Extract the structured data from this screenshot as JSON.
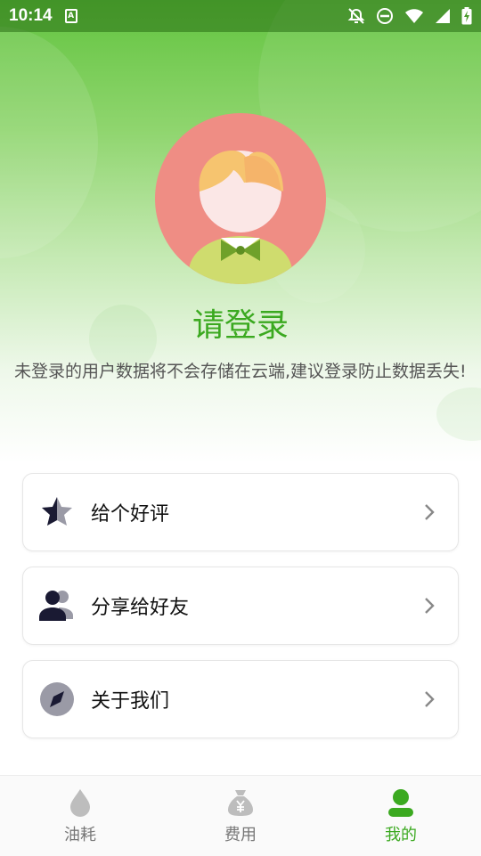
{
  "status_bar": {
    "time": "10:14",
    "notif_letter": "A"
  },
  "profile": {
    "login_title": "请登录",
    "login_desc": "未登录的用户数据将不会存储在云端,建议登录防止数据丢失!"
  },
  "menu": [
    {
      "label": "给个好评",
      "icon": "star-icon"
    },
    {
      "label": "分享给好友",
      "icon": "users-icon"
    },
    {
      "label": "关于我们",
      "icon": "compass-icon"
    }
  ],
  "tabs": [
    {
      "label": "油耗",
      "icon": "drop-icon",
      "active": false
    },
    {
      "label": "费用",
      "icon": "money-bag-icon",
      "active": false
    },
    {
      "label": "我的",
      "icon": "person-icon",
      "active": true
    }
  ],
  "colors": {
    "accent": "#3ba920",
    "avatar_bg": "#ef8d84"
  }
}
